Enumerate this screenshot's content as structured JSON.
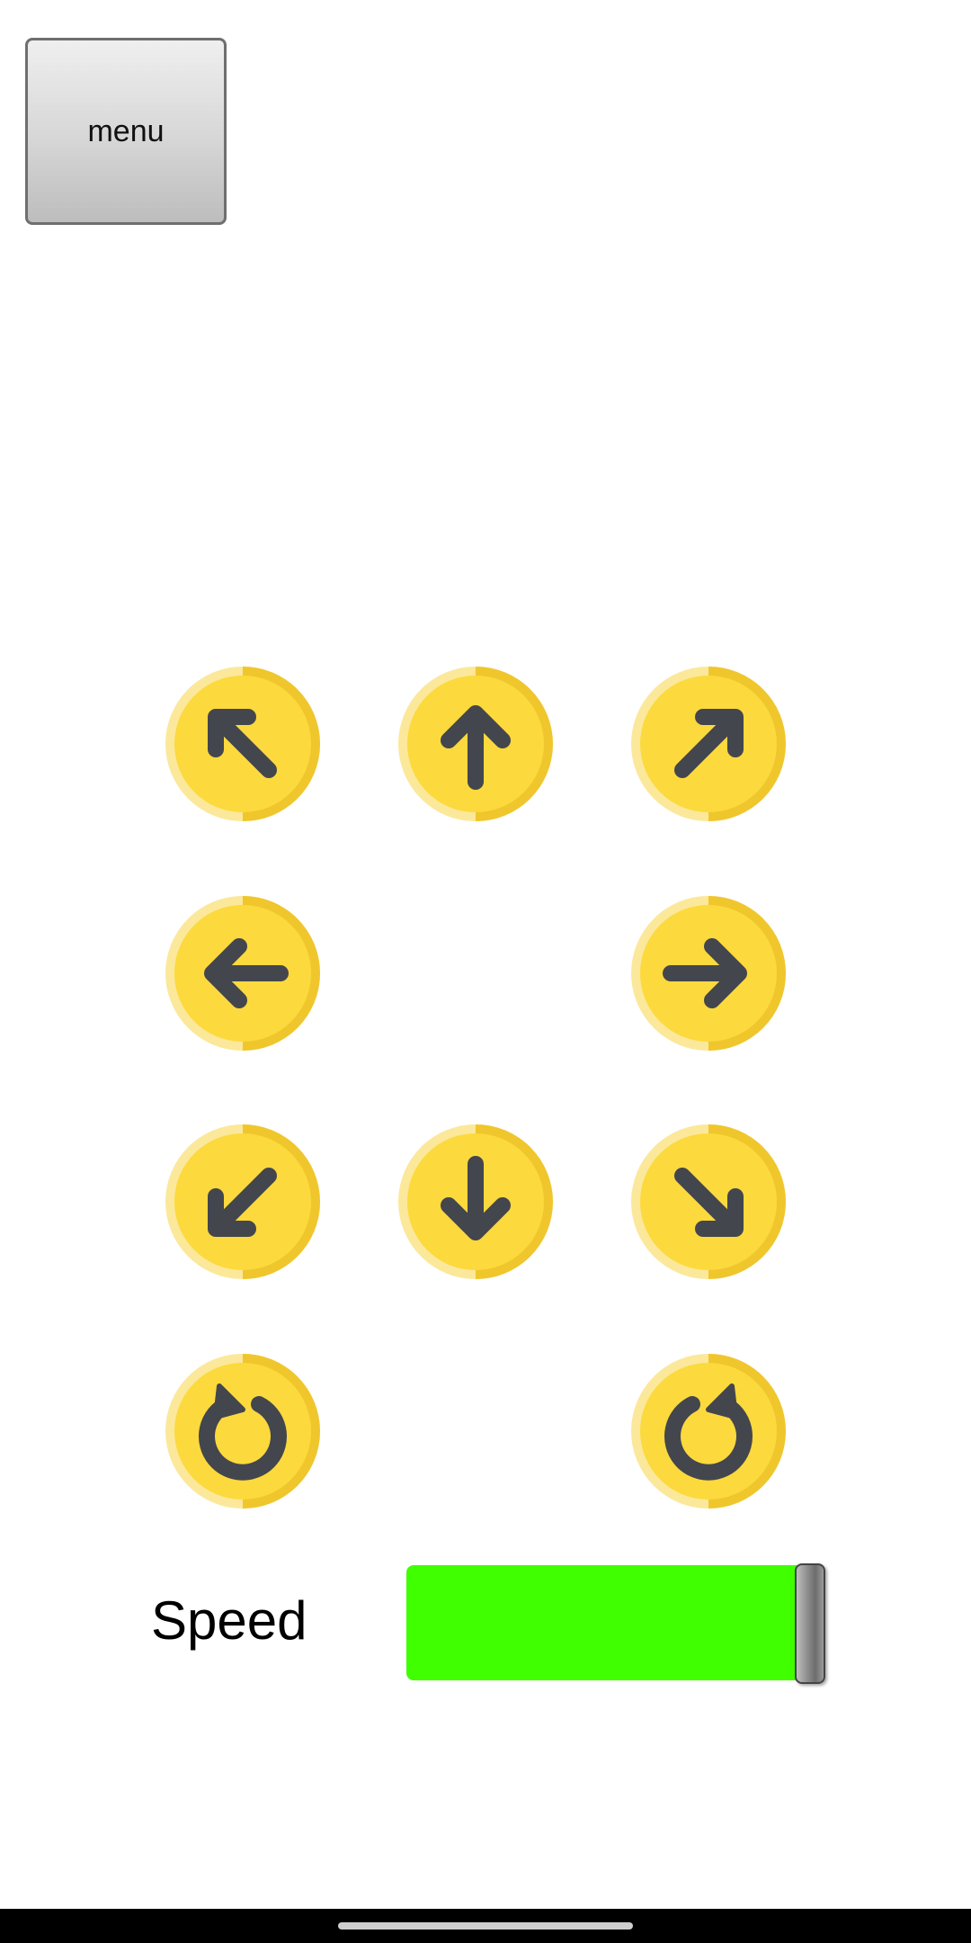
{
  "menu": {
    "label": "menu"
  },
  "controls": {
    "buttons": [
      {
        "name": "move-up-left-button",
        "icon": "arrow-up-left-icon",
        "row": 0,
        "col": 0
      },
      {
        "name": "move-up-button",
        "icon": "arrow-up-icon",
        "row": 0,
        "col": 1
      },
      {
        "name": "move-up-right-button",
        "icon": "arrow-up-right-icon",
        "row": 0,
        "col": 2
      },
      {
        "name": "move-left-button",
        "icon": "arrow-left-icon",
        "row": 1,
        "col": 0
      },
      {
        "name": "move-right-button",
        "icon": "arrow-right-icon",
        "row": 1,
        "col": 2
      },
      {
        "name": "move-down-left-button",
        "icon": "arrow-down-left-icon",
        "row": 2,
        "col": 0
      },
      {
        "name": "move-down-button",
        "icon": "arrow-down-icon",
        "row": 2,
        "col": 1
      },
      {
        "name": "move-down-right-button",
        "icon": "arrow-down-right-icon",
        "row": 2,
        "col": 2
      },
      {
        "name": "rotate-left-button",
        "icon": "rotate-counterclockwise-icon",
        "row": 3,
        "col": 0
      },
      {
        "name": "rotate-right-button",
        "icon": "rotate-clockwise-icon",
        "row": 3,
        "col": 2
      }
    ],
    "colors": {
      "face": "#fcd93d",
      "ring_dark": "#f0c62d",
      "ring_light": "#fbe89a",
      "arrow": "#43464d"
    }
  },
  "speed": {
    "label": "Speed",
    "value_percent": 100,
    "track_color": "#3fff00"
  }
}
